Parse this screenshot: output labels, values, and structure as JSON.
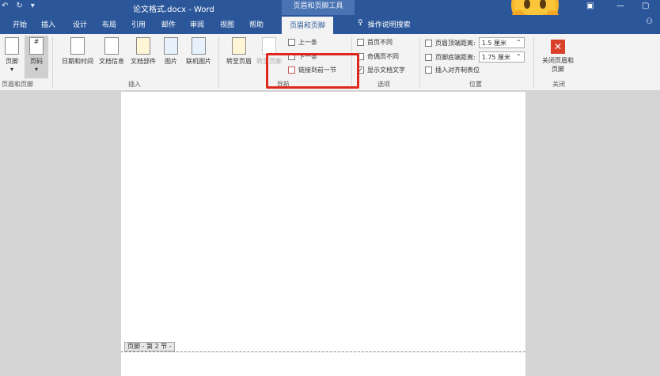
{
  "titlebar": {
    "qat": [
      "↶",
      "↻",
      "▾"
    ],
    "doc_title": "论文格式.docx - Word",
    "context_title": "页眉和页脚工具",
    "window_buttons": [
      "▣",
      "—",
      "▢"
    ]
  },
  "tabs": [
    "开始",
    "插入",
    "设计",
    "布局",
    "引用",
    "邮件",
    "审阅",
    "视图",
    "帮助"
  ],
  "active_tab": "页眉和页脚",
  "tell_me": "操作说明搜索",
  "ribbon": {
    "groups": {
      "header_footer": {
        "label": "页眉和页脚",
        "header": "页脚",
        "page_number": "页码"
      },
      "insert": {
        "label": "插入",
        "datetime": "日期和时间",
        "docinfo": "文档信息",
        "parts": "文档部件",
        "picture": "图片",
        "online_picture": "联机图片"
      },
      "navigation": {
        "label": "导航",
        "goto_header": "转至页眉",
        "goto_footer": "转至页脚",
        "prev": "上一条",
        "next": "下一条",
        "link_prev": "链接到前一节"
      },
      "options": {
        "label": "选项",
        "first_page": "首页不同",
        "odd_even": "奇偶页不同",
        "show_text": "显示文档文字"
      },
      "position": {
        "label": "位置",
        "header_top": "页眉顶端距离:",
        "header_top_val": "1.5 厘米",
        "footer_bottom": "页脚底端距离:",
        "footer_bottom_val": "1.75 厘米",
        "align_tab": "插入对齐制表位"
      },
      "close": {
        "label": "关闭",
        "btn": "关闭页眉和页脚"
      }
    }
  },
  "footer_tag": "页脚 - 第 2 节 -"
}
